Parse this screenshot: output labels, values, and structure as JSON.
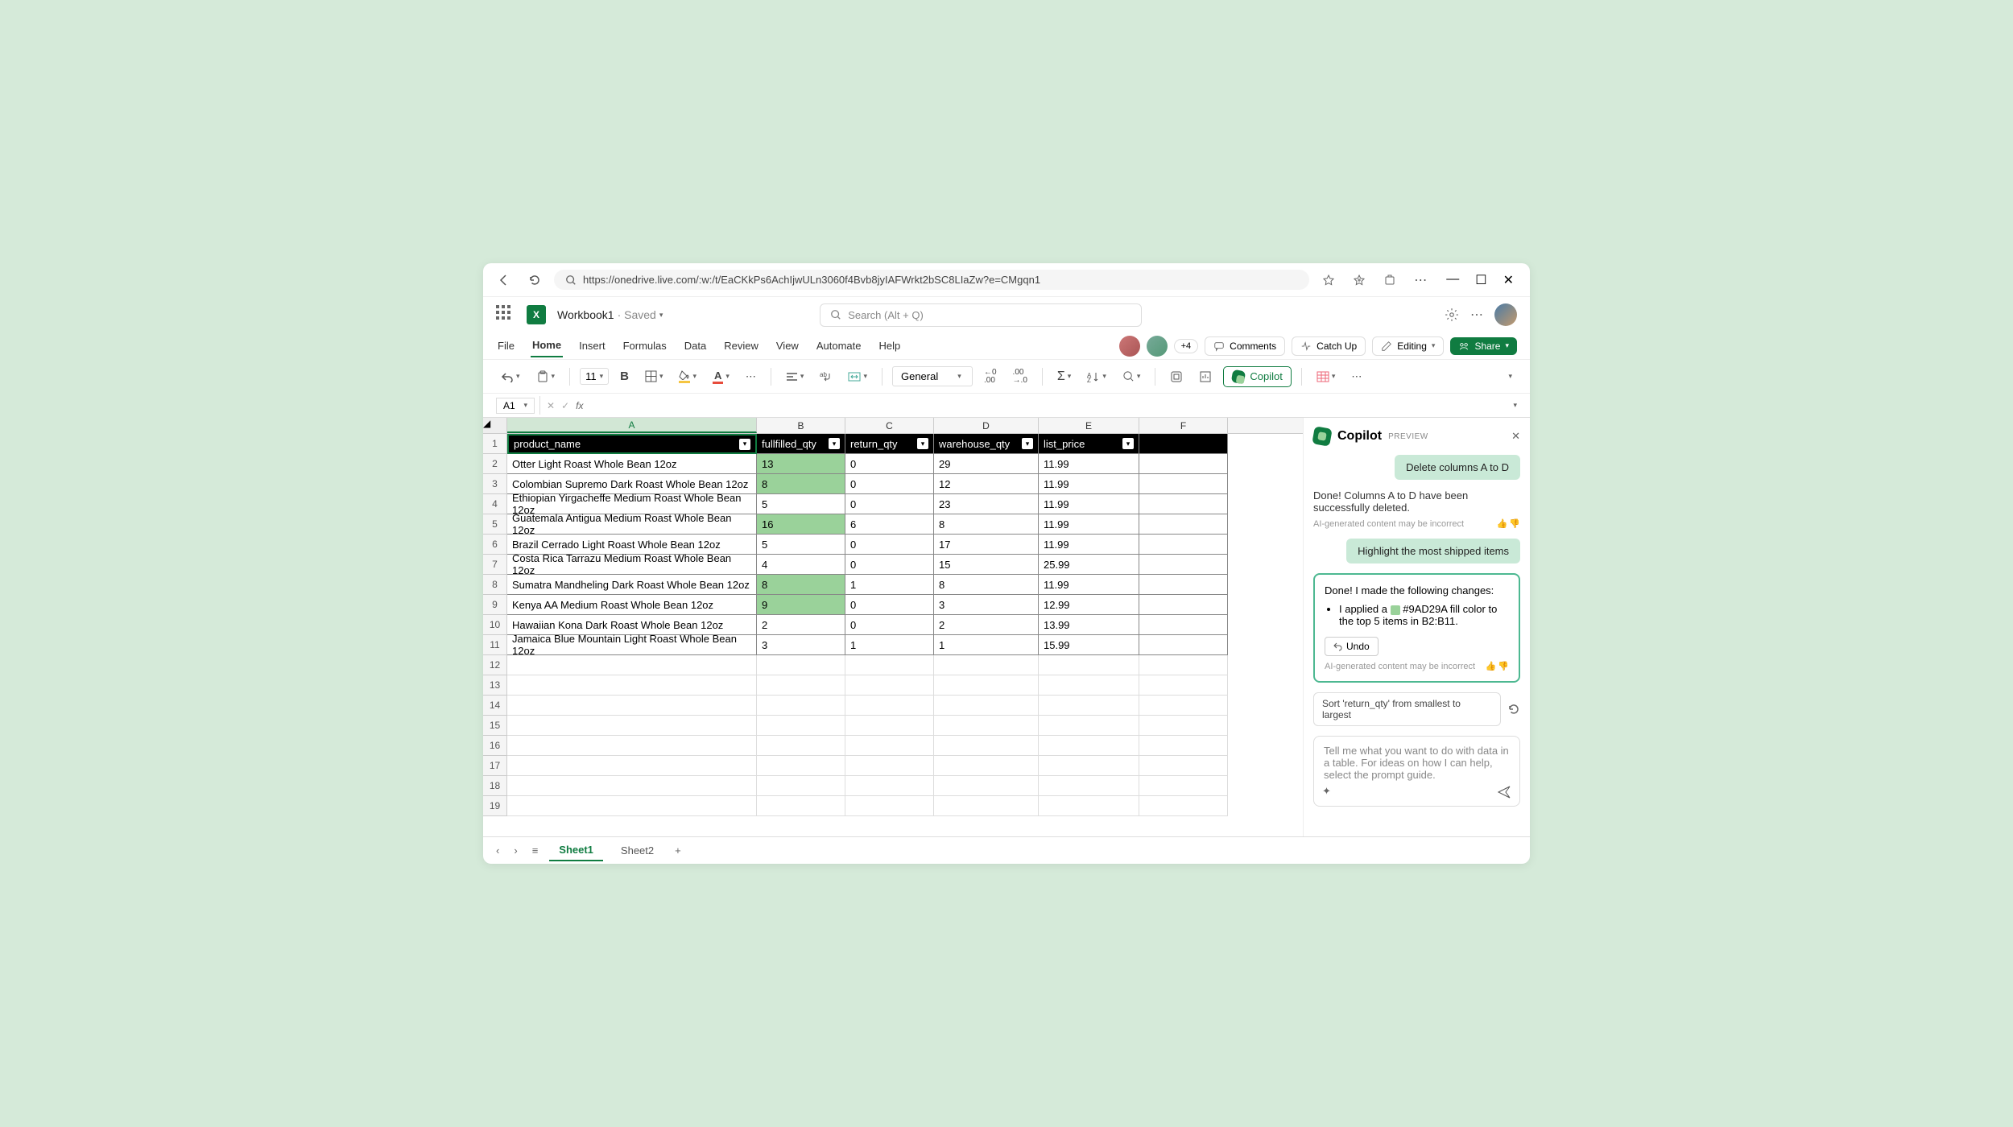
{
  "browser": {
    "url": "https://onedrive.live.com/:w:/t/EaCKkPs6AchIjwULn3060f4Bvb8jyIAFWrkt2bSC8LIaZw?e=CMgqn1"
  },
  "header": {
    "doc_name": "Workbook1",
    "doc_status": "· Saved",
    "search_placeholder": "Search (Alt + Q)"
  },
  "tabs": {
    "file": "File",
    "home": "Home",
    "insert": "Insert",
    "formulas": "Formulas",
    "data": "Data",
    "review": "Review",
    "view": "View",
    "automate": "Automate",
    "help": "Help",
    "presence_extra": "+4",
    "comments": "Comments",
    "catchup": "Catch Up",
    "editing": "Editing",
    "share": "Share"
  },
  "toolbar": {
    "font_size": "11",
    "number_format": "General",
    "copilot_label": "Copilot"
  },
  "formula": {
    "name_box": "A1",
    "fx": "fx"
  },
  "columns": [
    "A",
    "B",
    "C",
    "D",
    "E",
    "F"
  ],
  "table": {
    "headers": [
      "product_name",
      "fullfilled_qty",
      "return_qty",
      "warehouse_qty",
      "list_price"
    ],
    "rows": [
      {
        "n": "Otter Light Roast Whole Bean 12oz",
        "f": "13",
        "r": "0",
        "w": "29",
        "p": "11.99",
        "hl": true
      },
      {
        "n": "Colombian Supremo Dark Roast Whole Bean 12oz",
        "f": "8",
        "r": "0",
        "w": "12",
        "p": "11.99",
        "hl": true
      },
      {
        "n": "Ethiopian Yirgacheffe Medium Roast Whole Bean 12oz",
        "f": "5",
        "r": "0",
        "w": "23",
        "p": "11.99",
        "hl": false
      },
      {
        "n": "Guatemala Antigua Medium Roast Whole Bean 12oz",
        "f": "16",
        "r": "6",
        "w": "8",
        "p": "11.99",
        "hl": true
      },
      {
        "n": "Brazil Cerrado Light Roast Whole Bean 12oz",
        "f": "5",
        "r": "0",
        "w": "17",
        "p": "11.99",
        "hl": false
      },
      {
        "n": "Costa Rica Tarrazu Medium Roast Whole Bean 12oz",
        "f": "4",
        "r": "0",
        "w": "15",
        "p": "25.99",
        "hl": false
      },
      {
        "n": "Sumatra Mandheling Dark Roast Whole Bean 12oz",
        "f": "8",
        "r": "1",
        "w": "8",
        "p": "11.99",
        "hl": true
      },
      {
        "n": "Kenya AA Medium Roast Whole Bean 12oz",
        "f": "9",
        "r": "0",
        "w": "3",
        "p": "12.99",
        "hl": true
      },
      {
        "n": "Hawaiian Kona Dark Roast Whole Bean 12oz",
        "f": "2",
        "r": "0",
        "w": "2",
        "p": "13.99",
        "hl": false
      },
      {
        "n": "Jamaica Blue Mountain Light Roast Whole Bean 12oz",
        "f": "3",
        "r": "1",
        "w": "1",
        "p": "15.99",
        "hl": false
      }
    ]
  },
  "copilot": {
    "title": "Copilot",
    "preview": "PREVIEW",
    "msg1": "Delete columns A to D",
    "resp1": "Done! Columns A to D have been successfully deleted.",
    "disclaimer": "AI-generated content may be incorrect",
    "msg2": "Highlight the most shipped items",
    "resp2_intro": "Done! I made the following changes:",
    "resp2_item_a": "I applied a ",
    "resp2_color": "#9AD29A",
    "resp2_item_b": " fill color to the top 5 items in B2:B11.",
    "undo": "Undo",
    "suggestion": "Sort 'return_qty' from smallest to largest",
    "input_placeholder": "Tell me what you want to do with data in a table. For ideas on how I can help, select the prompt guide."
  },
  "sheets": {
    "s1": "Sheet1",
    "s2": "Sheet2"
  }
}
